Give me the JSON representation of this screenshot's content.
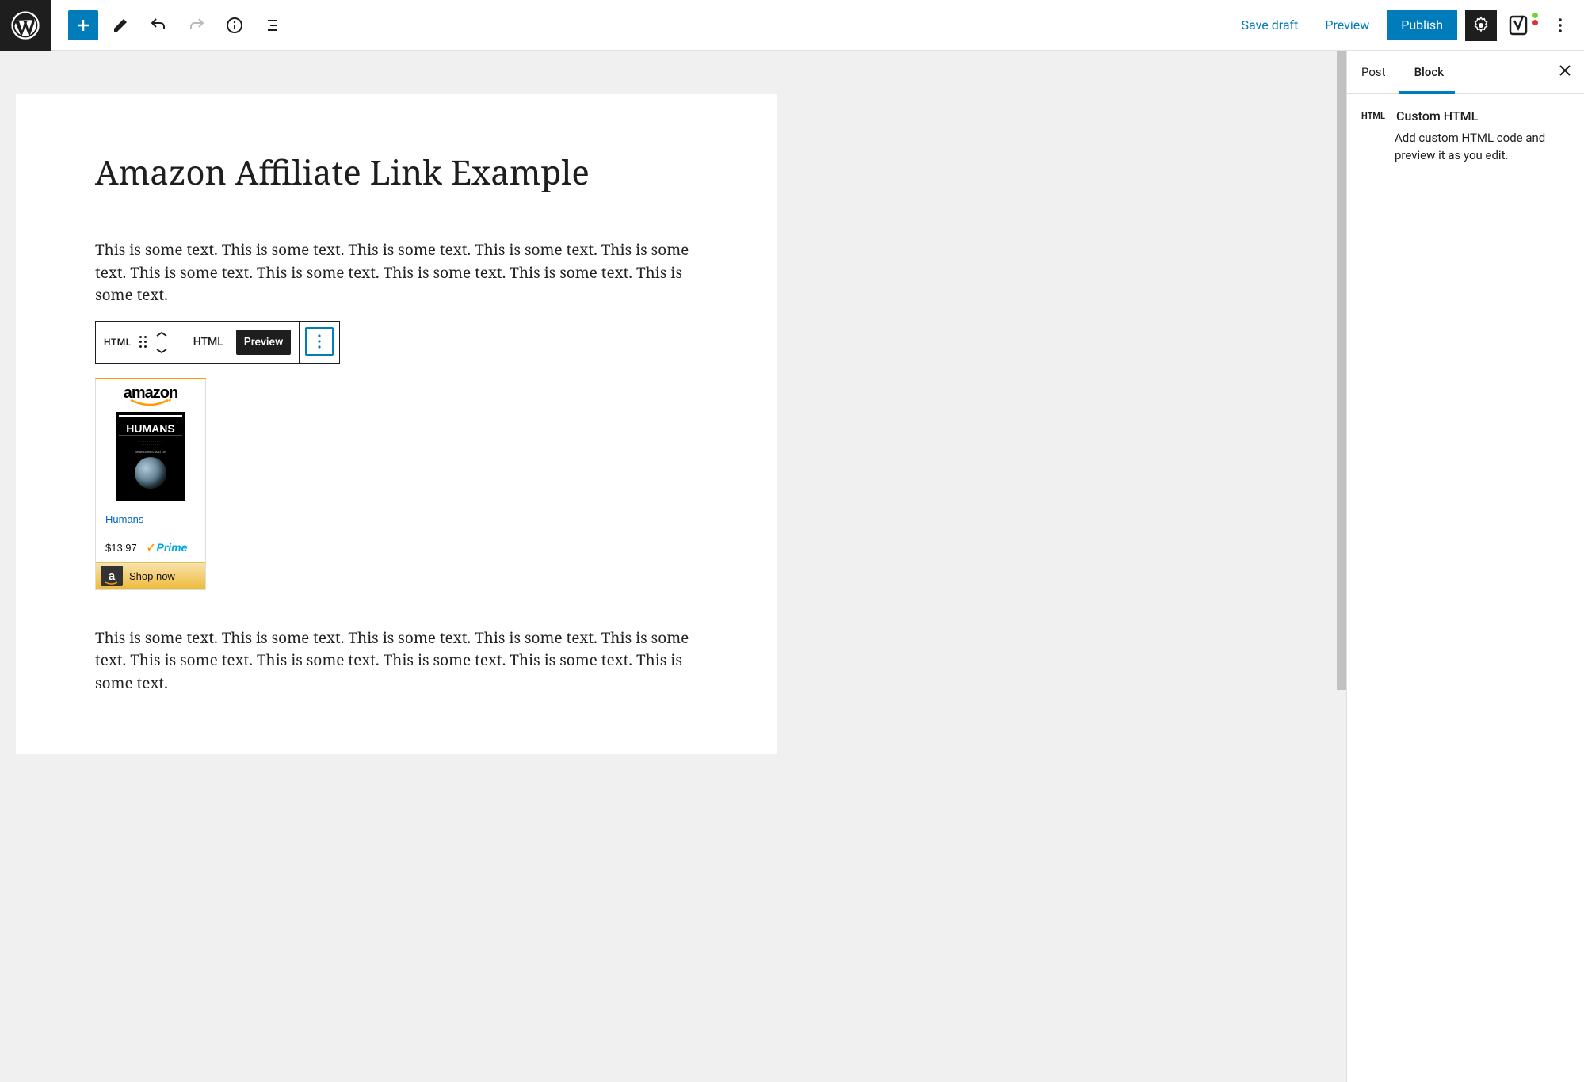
{
  "topbar": {
    "save_draft": "Save draft",
    "preview": "Preview",
    "publish": "Publish"
  },
  "editor": {
    "title": "Amazon Affiliate Link Example",
    "para1": "This is some text. This is some text.  This is some text. This is some text.  This is some text. This is some text.  This is some text. This is some text.  This is some text. This is some text.",
    "para2": " This is some text. This is some text.  This is some text. This is some text.  This is some text. This is some text.  This is some text. This is some text.  This is some text. This is some text."
  },
  "block_toolbar": {
    "type_label": "HTML",
    "tab_html": "HTML",
    "tab_preview": "Preview"
  },
  "amazon": {
    "logo": "amazon",
    "book_title": "HUMANS",
    "book_author": "BRANDON STANTON",
    "link_text": "Humans",
    "price": "$13.97",
    "prime": "Prime",
    "shop_label": "Shop now"
  },
  "sidebar": {
    "tab_post": "Post",
    "tab_block": "Block",
    "block_icon": "HTML",
    "block_title": "Custom HTML",
    "block_desc": "Add custom HTML code and preview it as you edit."
  }
}
